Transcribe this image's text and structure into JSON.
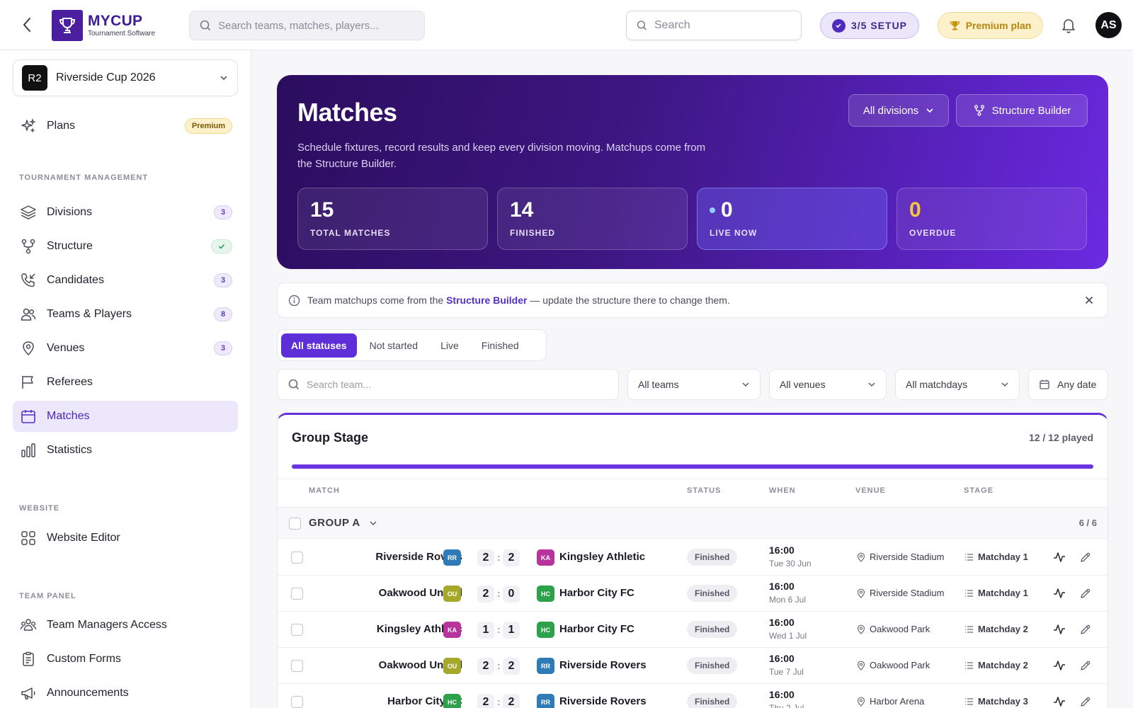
{
  "header": {
    "logo_name": "MYCUP",
    "logo_sub": "Tournament Software",
    "global_search_placeholder": "Search teams, matches, players...",
    "search_placeholder": "Search",
    "setup": "3/5 SETUP",
    "premium": "Premium plan",
    "avatar": "AS"
  },
  "sidebar": {
    "tournament_badge": "R2",
    "tournament_name": "Riverside Cup 2026",
    "plans_label": "Plans",
    "plans_badge": "Premium",
    "section_management": "TOURNAMENT MANAGEMENT",
    "section_website": "WEBSITE",
    "section_team_panel": "TEAM PANEL",
    "items": [
      {
        "label": "Divisions",
        "count": "3"
      },
      {
        "label": "Structure"
      },
      {
        "label": "Candidates",
        "count": "3"
      },
      {
        "label": "Teams & Players",
        "count": "8"
      },
      {
        "label": "Venues",
        "count": "3"
      },
      {
        "label": "Referees"
      },
      {
        "label": "Matches"
      },
      {
        "label": "Statistics"
      }
    ],
    "website_items": [
      {
        "label": "Website Editor"
      }
    ],
    "team_items": [
      {
        "label": "Team Managers Access"
      },
      {
        "label": "Custom Forms"
      },
      {
        "label": "Announcements"
      }
    ]
  },
  "hero": {
    "title": "Matches",
    "description": "Schedule fixtures, record results and keep every division moving. Matchups come from the Structure Builder.",
    "division_select": "All divisions",
    "structure_button": "Structure Builder",
    "stats": [
      {
        "value": "15",
        "label": "TOTAL MATCHES"
      },
      {
        "value": "14",
        "label": "FINISHED"
      },
      {
        "value": "0",
        "label": "LIVE NOW"
      },
      {
        "value": "0",
        "label": "OVERDUE"
      }
    ]
  },
  "banner": {
    "prefix": "Team matchups come from the",
    "link": "Structure Builder",
    "suffix": "— update the structure there to change them."
  },
  "tabs": [
    "All statuses",
    "Not started",
    "Live",
    "Finished"
  ],
  "filters": {
    "team_search_placeholder": "Search team...",
    "teams": "All teams",
    "venues": "All venues",
    "matchdays": "All matchdays",
    "date": "Any date"
  },
  "group_stage": {
    "title": "Group Stage",
    "played": "12 / 12 played",
    "progress": 1.0,
    "columns": [
      "MATCH",
      "STATUS",
      "WHEN",
      "VENUE",
      "STAGE"
    ],
    "group_name": "GROUP A",
    "group_count": "6 / 6",
    "matches": [
      {
        "home": "Riverside Rovers",
        "home_abbr": "RR",
        "home_color": "#2f7bb8",
        "home_score": "2",
        "away_score": "2",
        "away": "Kingsley Athletic",
        "away_abbr": "KA",
        "away_color": "#b8339c",
        "status": "Finished",
        "time": "16:00",
        "date": "Tue 30 Jun",
        "venue": "Riverside Stadium",
        "stage": "Matchday 1"
      },
      {
        "home": "Oakwood United",
        "home_abbr": "OU",
        "home_color": "#a6a82a",
        "home_score": "2",
        "away_score": "0",
        "away": "Harbor City FC",
        "away_abbr": "HC",
        "away_color": "#2ea24a",
        "status": "Finished",
        "time": "16:00",
        "date": "Mon 6 Jul",
        "venue": "Riverside Stadium",
        "stage": "Matchday 1"
      },
      {
        "home": "Kingsley Athletic",
        "home_abbr": "KA",
        "home_color": "#b8339c",
        "home_score": "1",
        "away_score": "1",
        "away": "Harbor City FC",
        "away_abbr": "HC",
        "away_color": "#2ea24a",
        "status": "Finished",
        "time": "16:00",
        "date": "Wed 1 Jul",
        "venue": "Oakwood Park",
        "stage": "Matchday 2"
      },
      {
        "home": "Oakwood United",
        "home_abbr": "OU",
        "home_color": "#a6a82a",
        "home_score": "2",
        "away_score": "2",
        "away": "Riverside Rovers",
        "away_abbr": "RR",
        "away_color": "#2f7bb8",
        "status": "Finished",
        "time": "16:00",
        "date": "Tue 7 Jul",
        "venue": "Oakwood Park",
        "stage": "Matchday 2"
      },
      {
        "home": "Harbor City FC",
        "home_abbr": "HC",
        "home_color": "#2ea24a",
        "home_score": "2",
        "away_score": "2",
        "away": "Riverside Rovers",
        "away_abbr": "RR",
        "away_color": "#2f7bb8",
        "status": "Finished",
        "time": "16:00",
        "date": "Thu 2 Jul",
        "venue": "Harbor Arena",
        "stage": "Matchday 3"
      }
    ]
  }
}
